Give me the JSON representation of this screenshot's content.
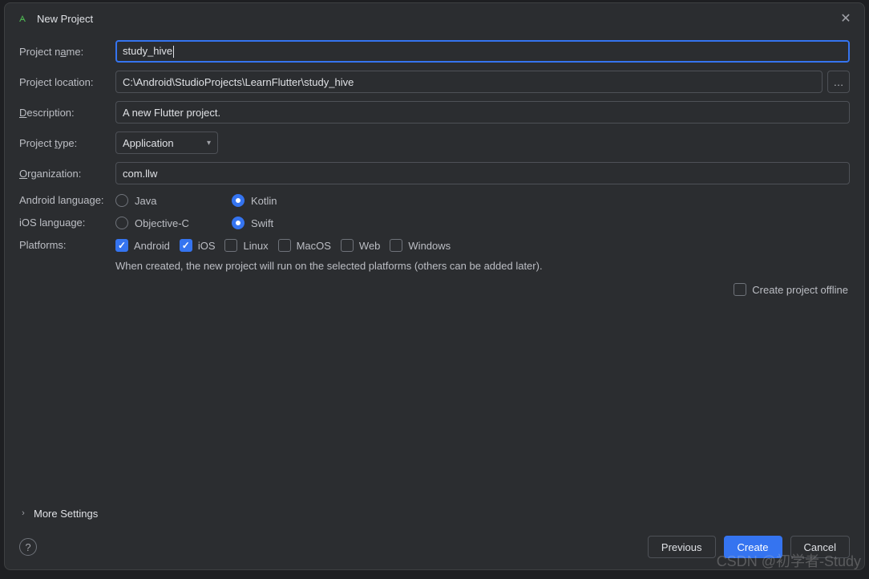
{
  "dialog": {
    "title": "New Project",
    "close_aria": "Close"
  },
  "labels": {
    "project_name_pre": "Project n",
    "project_name_mn": "a",
    "project_name_post": "me:",
    "project_location": "Project location:",
    "description_mn": "D",
    "description_post": "escription:",
    "project_type_pre": "Project ",
    "project_type_mn": "t",
    "project_type_post": "ype:",
    "organization_mn": "O",
    "organization_post": "rganization:",
    "android_language": "Android language:",
    "ios_language": "iOS language:",
    "platforms": "Platforms:"
  },
  "values": {
    "project_name": "study_hive",
    "project_location": "C:\\Android\\StudioProjects\\LearnFlutter\\study_hive",
    "description": "A new Flutter project.",
    "project_type": "Application",
    "organization": "com.llw"
  },
  "android_lang_options": [
    {
      "label": "Java",
      "checked": false
    },
    {
      "label": "Kotlin",
      "checked": true
    }
  ],
  "ios_lang_options": [
    {
      "label": "Objective-C",
      "checked": false
    },
    {
      "label": "Swift",
      "checked": true
    }
  ],
  "platforms": [
    {
      "label": "Android",
      "checked": true
    },
    {
      "label": "iOS",
      "checked": true
    },
    {
      "label": "Linux",
      "checked": false
    },
    {
      "label": "MacOS",
      "checked": false
    },
    {
      "label": "Web",
      "checked": false
    },
    {
      "label": "Windows",
      "checked": false
    }
  ],
  "hints": {
    "platforms": "When created, the new project will run on the selected platforms (others can be added later)."
  },
  "offline": {
    "label": "Create project offline",
    "checked": false
  },
  "more_settings": "More Settings",
  "footer": {
    "previous": "Previous",
    "create": "Create",
    "cancel": "Cancel"
  },
  "watermark": "CSDN @初学者-Study"
}
